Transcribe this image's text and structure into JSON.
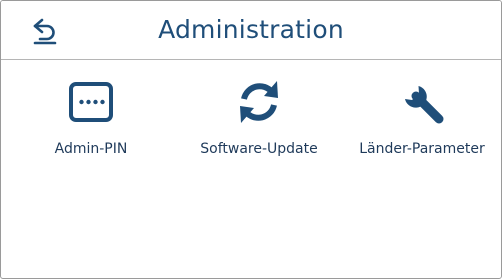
{
  "header": {
    "title": "Administration",
    "back_icon": "back-arrow-icon"
  },
  "tiles": [
    {
      "label": "Admin-PIN",
      "icon": "pin-dots-icon"
    },
    {
      "label": "Software-Update",
      "icon": "refresh-icon"
    },
    {
      "label": "Länder-Parameter",
      "icon": "wrench-icon"
    }
  ],
  "colors": {
    "accent": "#1f4e79",
    "border": "#9a9a9a"
  }
}
